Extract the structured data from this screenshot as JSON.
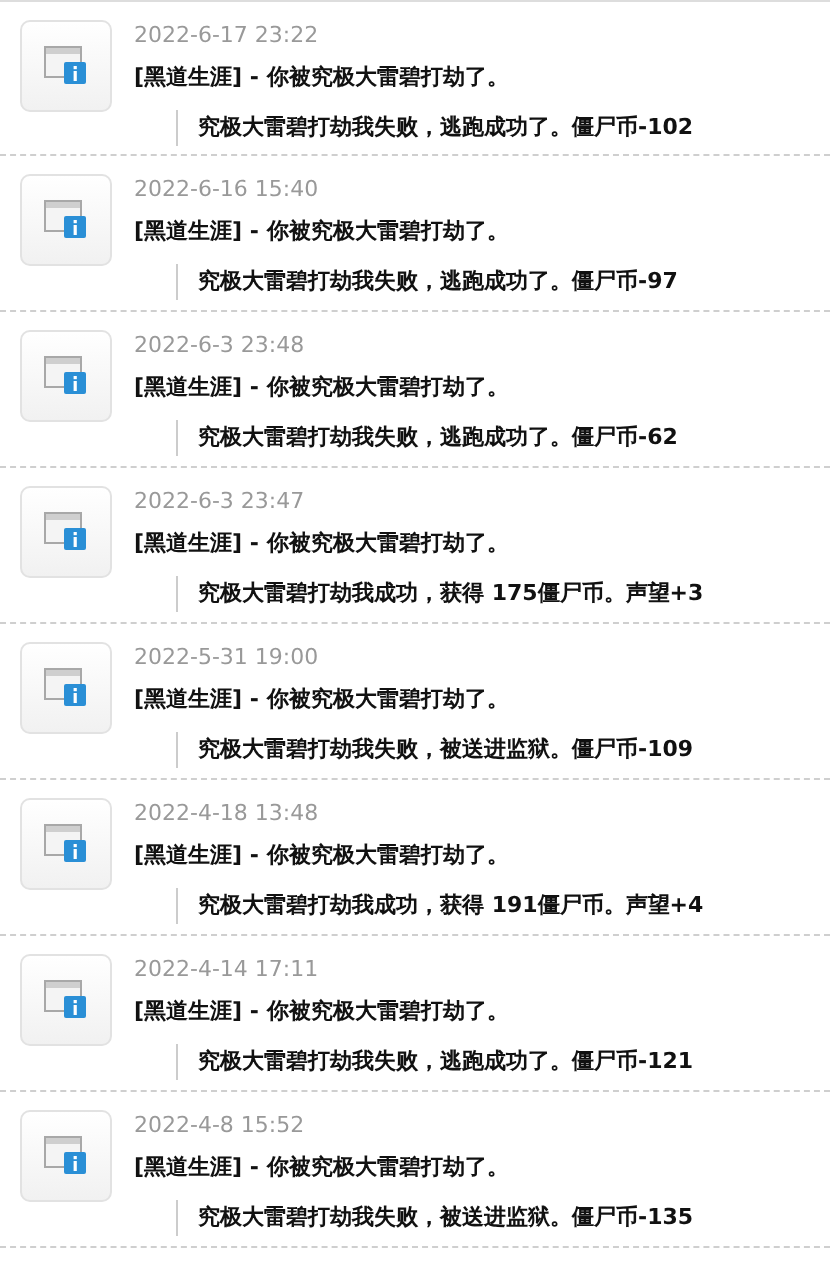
{
  "notices": [
    {
      "time": "2022-6-17 23:22",
      "title": "[黑道生涯] - 你被究极大雷碧打劫了。",
      "message": "究极大雷碧打劫我失败，逃跑成功了。僵尸币-102"
    },
    {
      "time": "2022-6-16 15:40",
      "title": "[黑道生涯] - 你被究极大雷碧打劫了。",
      "message": "究极大雷碧打劫我失败，逃跑成功了。僵尸币-97"
    },
    {
      "time": "2022-6-3 23:48",
      "title": "[黑道生涯] - 你被究极大雷碧打劫了。",
      "message": "究极大雷碧打劫我失败，逃跑成功了。僵尸币-62"
    },
    {
      "time": "2022-6-3 23:47",
      "title": "[黑道生涯] - 你被究极大雷碧打劫了。",
      "message": "究极大雷碧打劫我成功，获得 175僵尸币。声望+3"
    },
    {
      "time": "2022-5-31 19:00",
      "title": "[黑道生涯] - 你被究极大雷碧打劫了。",
      "message": "究极大雷碧打劫我失败，被送进监狱。僵尸币-109"
    },
    {
      "time": "2022-4-18 13:48",
      "title": "[黑道生涯] - 你被究极大雷碧打劫了。",
      "message": "究极大雷碧打劫我成功，获得 191僵尸币。声望+4"
    },
    {
      "time": "2022-4-14 17:11",
      "title": "[黑道生涯] - 你被究极大雷碧打劫了。",
      "message": "究极大雷碧打劫我失败，逃跑成功了。僵尸币-121"
    },
    {
      "time": "2022-4-8 15:52",
      "title": "[黑道生涯] - 你被究极大雷碧打劫了。",
      "message": "究极大雷碧打劫我失败，被送进监狱。僵尸币-135"
    }
  ]
}
